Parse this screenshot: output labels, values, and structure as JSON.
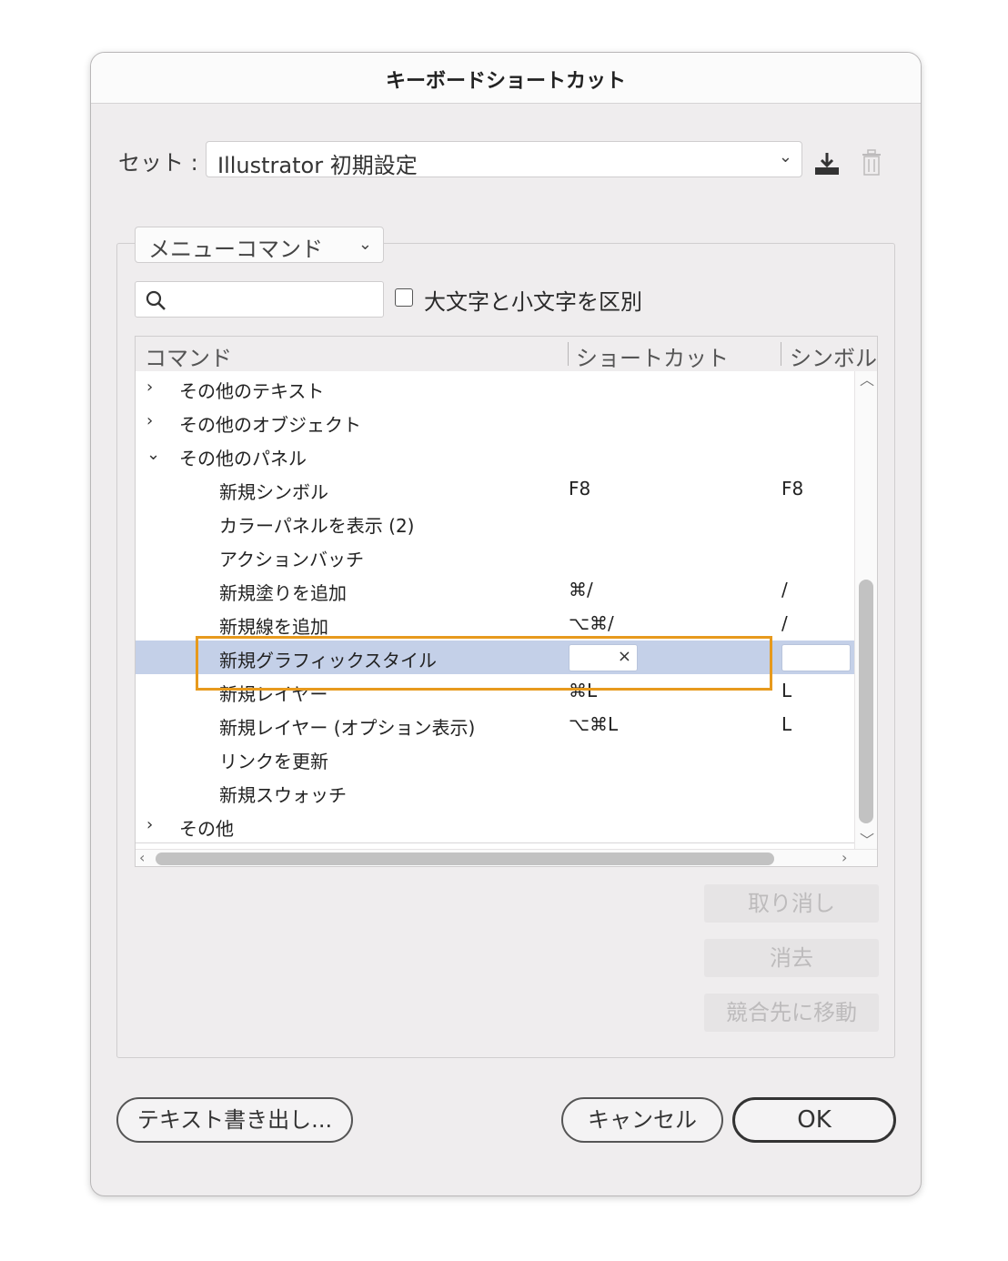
{
  "dialog": {
    "title": "キーボードショートカット"
  },
  "set": {
    "label": "セット :",
    "value": "Illustrator 初期設定",
    "download_icon": "download-icon",
    "trash_icon": "trash-icon"
  },
  "command_type": {
    "value": "メニューコマンド"
  },
  "search": {
    "value": "",
    "placeholder": ""
  },
  "case_sensitive": {
    "label": "大文字と小文字を区別",
    "checked": false
  },
  "table": {
    "headers": [
      "コマンド",
      "ショートカット",
      "シンボル"
    ],
    "rows": [
      {
        "arrow": "›",
        "command": "その他のテキスト",
        "shortcut": "",
        "symbol": ""
      },
      {
        "arrow": "›",
        "command": "その他のオブジェクト",
        "shortcut": "",
        "symbol": ""
      },
      {
        "arrow": "⌄",
        "command": "その他のパネル",
        "shortcut": "",
        "symbol": ""
      },
      {
        "arrow": "",
        "command": "新規シンボル",
        "shortcut": "F8",
        "symbol": "F8"
      },
      {
        "arrow": "",
        "command": "カラーパネルを表示 (2)",
        "shortcut": "",
        "symbol": ""
      },
      {
        "arrow": "",
        "command": "アクションバッチ",
        "shortcut": "",
        "symbol": ""
      },
      {
        "arrow": "",
        "command": "新規塗りを追加",
        "shortcut": "⌘/",
        "symbol": "/"
      },
      {
        "arrow": "",
        "command": "新規線を追加",
        "shortcut": "⌥⌘/",
        "symbol": "/"
      },
      {
        "arrow": "",
        "command": "新規グラフィックスタイル",
        "shortcut": "",
        "symbol": "",
        "clear": "×"
      },
      {
        "arrow": "",
        "command": "新規レイヤー",
        "shortcut": "⌘L",
        "symbol": "L"
      },
      {
        "arrow": "",
        "command": "新規レイヤー (オプション表示)",
        "shortcut": "⌥⌘L",
        "symbol": "L"
      },
      {
        "arrow": "",
        "command": "リンクを更新",
        "shortcut": "",
        "symbol": ""
      },
      {
        "arrow": "",
        "command": "新規スウォッチ",
        "shortcut": "",
        "symbol": ""
      },
      {
        "arrow": "›",
        "command": "その他",
        "shortcut": "",
        "symbol": ""
      }
    ]
  },
  "side_buttons": {
    "undo": "取り消し",
    "clear": "消去",
    "goto_conflict": "競合先に移動"
  },
  "footer": {
    "export_text": "テキスト書き出し...",
    "cancel": "キャンセル",
    "ok": "OK"
  },
  "colors": {
    "selection": "#c4d0e8",
    "highlight": "#e79a1d"
  }
}
